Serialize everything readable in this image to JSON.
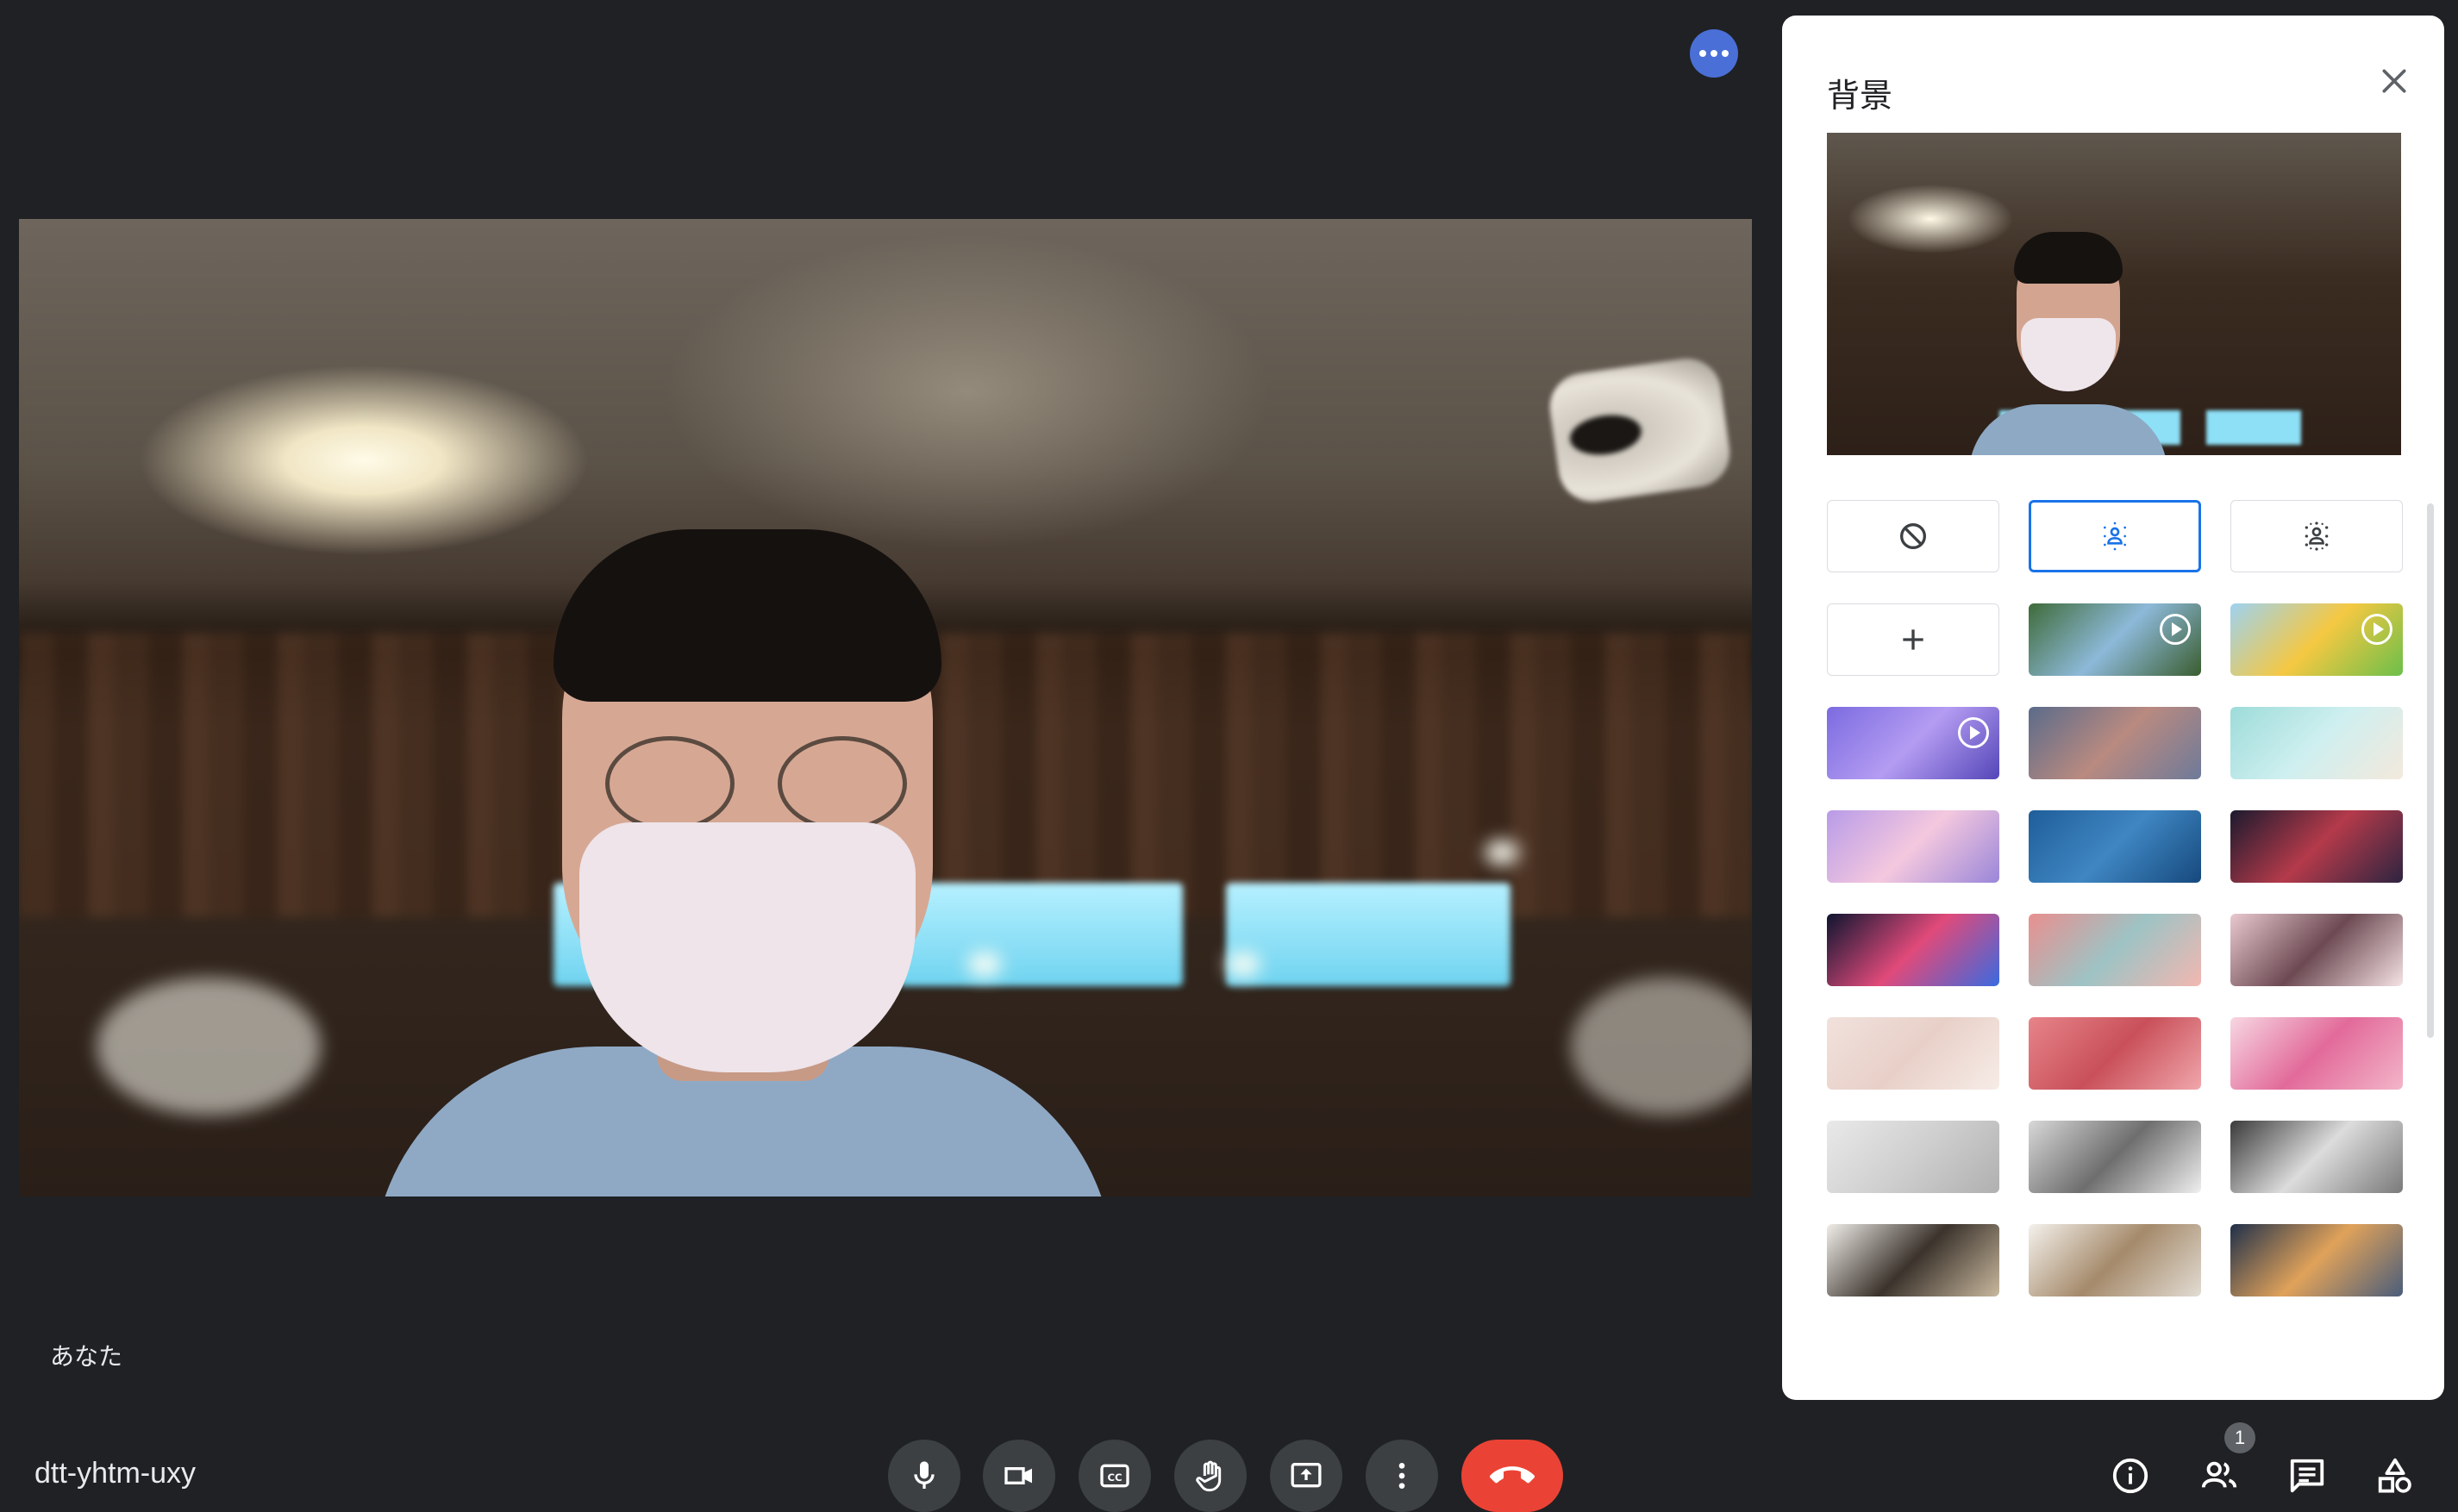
{
  "meeting": {
    "code": "dtt-yhtm-uxy",
    "self_label": "あなた",
    "participant_count": "1"
  },
  "panel": {
    "title": "背景"
  },
  "colors": {
    "background": "#202124",
    "control": "#3c4043",
    "hangup": "#ea4335",
    "accent_selected": "#1a73e8",
    "more_button": "#4a6fd6"
  },
  "icons": {
    "more": "more-horizontal-icon",
    "mic": "mic-icon",
    "camera": "videocam-icon",
    "captions": "closed-caption-icon",
    "raise_hand": "hand-icon",
    "present": "present-screen-icon",
    "more_options": "more-vertical-icon",
    "hangup": "call-end-icon",
    "info": "info-icon",
    "people": "people-icon",
    "chat": "chat-icon",
    "activities": "activities-icon",
    "close": "close-icon"
  },
  "backgrounds": [
    {
      "id": "no-effect",
      "kind": "icon",
      "icon": "block-icon"
    },
    {
      "id": "slight-blur",
      "kind": "icon",
      "icon": "blur-slight-icon",
      "selected": true
    },
    {
      "id": "blur",
      "kind": "icon",
      "icon": "blur-icon"
    },
    {
      "id": "upload",
      "kind": "icon",
      "icon": "add-icon"
    },
    {
      "id": "animated-forest",
      "kind": "image",
      "animated": true,
      "colors": [
        "#3f6b3a",
        "#8db9d9",
        "#3a5d2f"
      ]
    },
    {
      "id": "animated-classroom",
      "kind": "image",
      "animated": true,
      "colors": [
        "#9ed2f0",
        "#f5c842",
        "#6bbf4a"
      ]
    },
    {
      "id": "animated-purple-room",
      "kind": "image",
      "animated": true,
      "colors": [
        "#7b6be0",
        "#b49cf2",
        "#5446b8"
      ]
    },
    {
      "id": "sunset",
      "kind": "image",
      "colors": [
        "#5b6b8a",
        "#b98a80",
        "#6e7a99"
      ]
    },
    {
      "id": "beach",
      "kind": "image",
      "colors": [
        "#9ddcd9",
        "#cfeff0",
        "#f3e9dc"
      ]
    },
    {
      "id": "clouds",
      "kind": "image",
      "colors": [
        "#b89be8",
        "#f4c8de",
        "#9a86d9"
      ]
    },
    {
      "id": "water",
      "kind": "image",
      "colors": [
        "#1f5e9a",
        "#3f86c2",
        "#16497d"
      ]
    },
    {
      "id": "galaxy",
      "kind": "image",
      "colors": [
        "#1c1a2e",
        "#b43a4a",
        "#2d2440"
      ]
    },
    {
      "id": "fireworks",
      "kind": "image",
      "colors": [
        "#0e1530",
        "#e04a7a",
        "#3a6ae0"
      ]
    },
    {
      "id": "flowers-pink",
      "kind": "image",
      "colors": [
        "#e98f8f",
        "#9ec3c4",
        "#f2b7b0"
      ]
    },
    {
      "id": "flowers-field",
      "kind": "image",
      "colors": [
        "#e9c9cf",
        "#6d4a53",
        "#f5e2e4"
      ]
    },
    {
      "id": "confetti-beige",
      "kind": "image",
      "colors": [
        "#f1e1dc",
        "#e8d0c8",
        "#f7ece7"
      ]
    },
    {
      "id": "pattern-red",
      "kind": "image",
      "colors": [
        "#e7848a",
        "#c9505a",
        "#f0a6ab"
      ]
    },
    {
      "id": "petals",
      "kind": "image",
      "colors": [
        "#f7d7e2",
        "#e26a9a",
        "#f3b5c8"
      ]
    },
    {
      "id": "office-white",
      "kind": "image",
      "colors": [
        "#e9e9e9",
        "#cfcfcf",
        "#b0b0b0"
      ]
    },
    {
      "id": "office-atrium",
      "kind": "image",
      "colors": [
        "#d8d8d8",
        "#6e6e6e",
        "#efefef"
      ]
    },
    {
      "id": "office-dark",
      "kind": "image",
      "colors": [
        "#3a3a3a",
        "#dcdcdc",
        "#7a7a7a"
      ]
    },
    {
      "id": "shelves-lamp",
      "kind": "image",
      "colors": [
        "#f0ede8",
        "#3b332c",
        "#c9b89e"
      ]
    },
    {
      "id": "shelves-white",
      "kind": "image",
      "colors": [
        "#f4f1ec",
        "#a58a6b",
        "#e2dcd3"
      ]
    },
    {
      "id": "cabin-night",
      "kind": "image",
      "colors": [
        "#20304a",
        "#e0a25a",
        "#4a5d7a"
      ]
    }
  ]
}
